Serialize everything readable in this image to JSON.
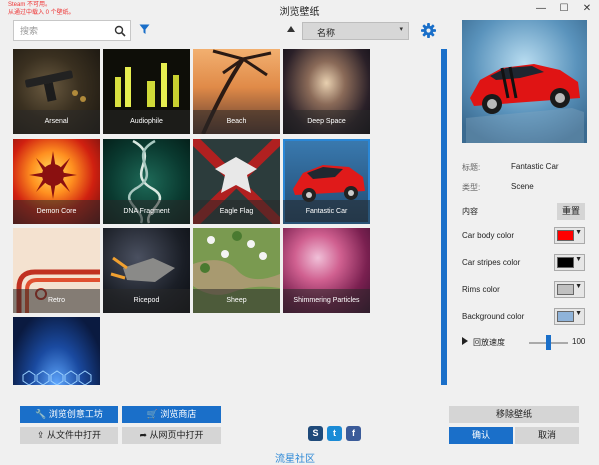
{
  "window": {
    "title": "浏览壁纸",
    "minimize": "—",
    "maximize": "☐",
    "close": "✕",
    "warning_line1": "Steam 不可用。",
    "warning_line2": "从通过中载入 0 个壁纸。"
  },
  "search": {
    "placeholder": "搜索"
  },
  "sort": {
    "selected": "名称",
    "chevron": "▾"
  },
  "wallpapers": [
    {
      "title": "Arsenal"
    },
    {
      "title": "Audiophile"
    },
    {
      "title": "Beach"
    },
    {
      "title": "Deep Space"
    },
    {
      "title": "Demon Core"
    },
    {
      "title": "DNA Fragment"
    },
    {
      "title": "Eagle Flag"
    },
    {
      "title": "Fantastic Car",
      "selected": true
    },
    {
      "title": "Retro"
    },
    {
      "title": "Ricepod"
    },
    {
      "title": "Sheep"
    },
    {
      "title": "Shimmering Particles"
    },
    {
      "title": ""
    }
  ],
  "bottom": {
    "browse_workshop": "浏览创意工坊",
    "browse_store": "浏览商店",
    "open_file": "从文件中打开",
    "open_web": "从网页中打开",
    "community": "流星社区",
    "social": {
      "steam": "S",
      "twitter": "t",
      "facebook": "f"
    }
  },
  "details": {
    "title_label": "标题:",
    "title_value": "Fantastic Car",
    "type_label": "类型:",
    "type_value": "Scene",
    "content_label": "内容",
    "reset": "重置",
    "colors": [
      {
        "label": "Car body color",
        "hex": "#ff0000"
      },
      {
        "label": "Car stripes color",
        "hex": "#000000"
      },
      {
        "label": "Rims color",
        "hex": "#c0c0c0"
      },
      {
        "label": "Background color",
        "hex": "#8fb3d9"
      }
    ],
    "swatch_arrow": "▼",
    "speed_label": "回放速度",
    "speed_value": "100"
  },
  "actions": {
    "remove": "移除壁纸",
    "ok": "确认",
    "cancel": "取消"
  },
  "accent": "#1a6fc9"
}
